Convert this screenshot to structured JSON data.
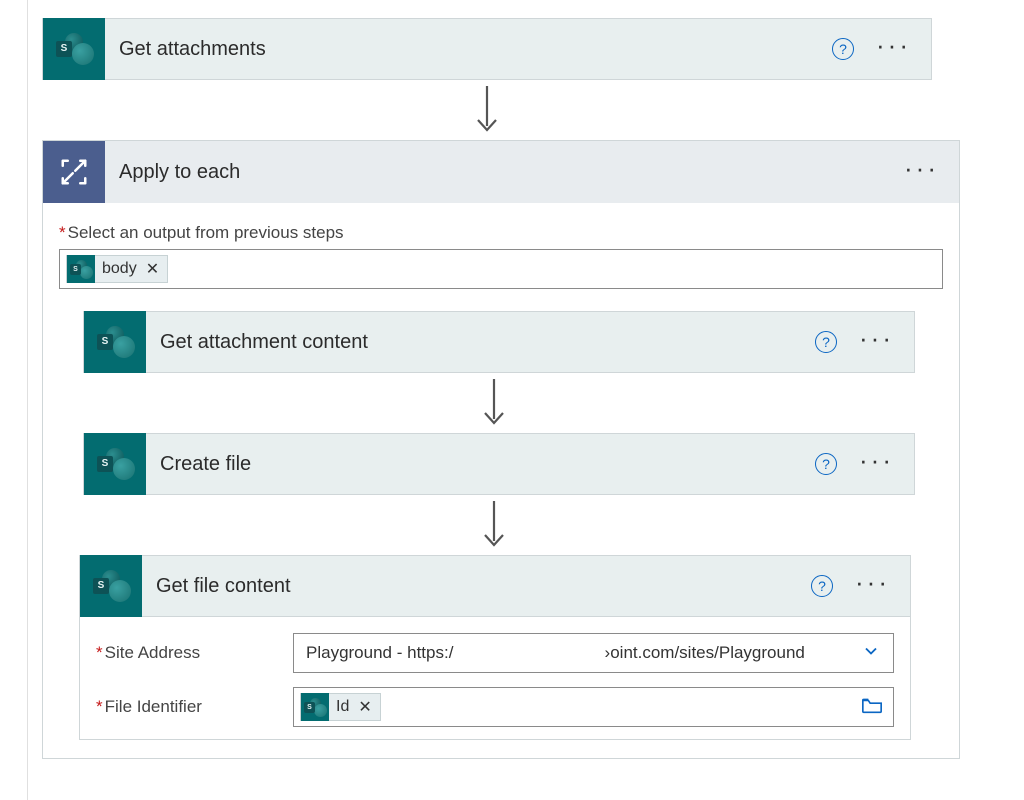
{
  "actions": {
    "get_attachments": {
      "title": "Get attachments"
    },
    "apply_to_each": {
      "title": "Apply to each",
      "output_label": "Select an output from previous steps",
      "body_token": "body"
    },
    "get_attachment_content": {
      "title": "Get attachment content"
    },
    "create_file": {
      "title": "Create file"
    },
    "get_file_content": {
      "title": "Get file content",
      "site_address_label": "Site Address",
      "site_address_value": "Playground - https:/                                ›oint.com/sites/Playground",
      "file_identifier_label": "File Identifier",
      "id_token": "Id"
    }
  }
}
